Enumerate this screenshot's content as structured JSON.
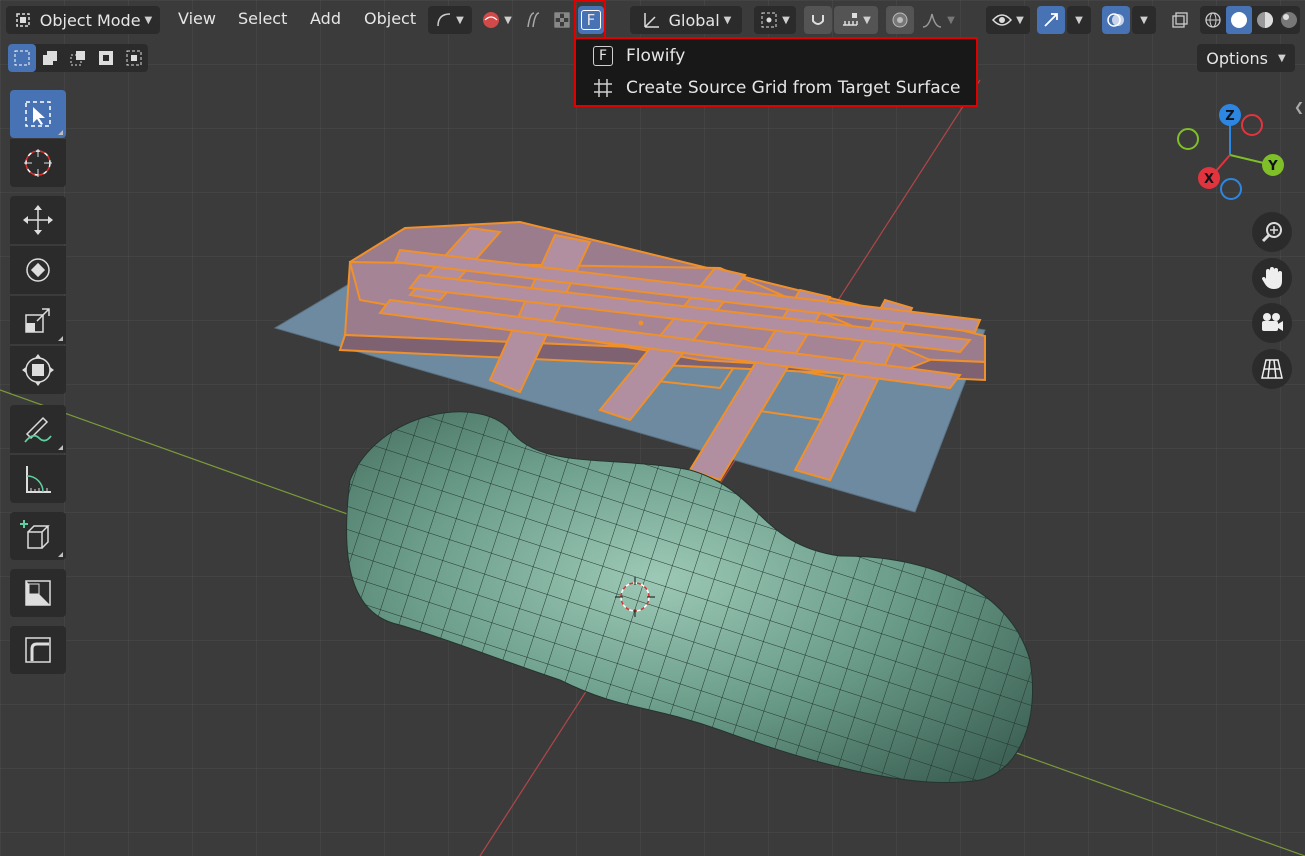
{
  "header": {
    "mode_label": "Object Mode",
    "menus": [
      "View",
      "Select",
      "Add",
      "Object"
    ],
    "addon_button_label": "F",
    "transform_orientation": "Global"
  },
  "dropdown": {
    "items": [
      {
        "label": "Flowify",
        "icon_text": "F",
        "icon": "flowify-f-icon"
      },
      {
        "label": "Create Source Grid from Target Surface",
        "icon": "grid-icon"
      }
    ]
  },
  "toolbar2": {
    "options_label": "Options"
  },
  "gizmo": {
    "axes": {
      "x": "X",
      "y": "Y",
      "z": "Z"
    },
    "colors": {
      "x": "#e2343e",
      "y": "#7fbf28",
      "z": "#2d87e2"
    }
  },
  "tools": [
    {
      "name": "select-box-tool",
      "icon": "cursor-select-icon",
      "active": true
    },
    {
      "name": "cursor-tool",
      "icon": "3d-cursor-icon"
    },
    {
      "name": "move-tool",
      "icon": "move-icon"
    },
    {
      "name": "rotate-tool",
      "icon": "rotate-icon"
    },
    {
      "name": "scale-tool",
      "icon": "scale-icon"
    },
    {
      "name": "transform-tool",
      "icon": "transform-icon"
    },
    {
      "name": "annotate-tool",
      "icon": "annotate-icon"
    },
    {
      "name": "measure-tool",
      "icon": "measure-icon"
    },
    {
      "name": "add-cube-tool",
      "icon": "add-cube-icon"
    },
    {
      "name": "shrink-tool",
      "icon": "shrink-icon"
    },
    {
      "name": "bevel-tool",
      "icon": "bevel-icon"
    }
  ],
  "colors": {
    "accent": "#4772b3",
    "highlight_border": "#e00000",
    "selection_outline": "#f0902a",
    "grid_mesh": "#9b7c8c",
    "plane": "#6e8aa0",
    "surface": "#6a9c8a"
  }
}
